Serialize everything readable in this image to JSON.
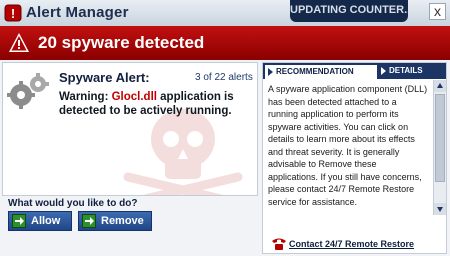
{
  "window": {
    "title": "Alert Manager",
    "counter_text": "UPDATING COUNTER...",
    "close_label": "x"
  },
  "banner": {
    "text": "20 spyware detected"
  },
  "alert": {
    "title": "Spyware Alert:",
    "count": "3 of 22 alerts",
    "warning_prefix": "Warning: ",
    "dll_name": "Glocl.dll",
    "warning_suffix": " application is detected to be actively running."
  },
  "actions": {
    "prompt": "What would you like to do?",
    "allow_label": "Allow",
    "remove_label": "Remove"
  },
  "tabs": [
    {
      "label": "RECOMMENDATION",
      "active": true
    },
    {
      "label": "DETAILS",
      "active": false
    }
  ],
  "recommendation_text": "A spyware application component (DLL) has been detected attached to a running application to perform its spyware activities. You can click on details to learn more about its effects and threat severity.   It is generally advisable to Remove these applications. If you still have concerns, please contact 24/7 Remote Restore service for assistance.",
  "contact_link": "Contact 24/7 Remote Restore",
  "colors": {
    "banner_red": "#b30000",
    "navy": "#1c3564",
    "button_blue": "#2a56a0",
    "dll_red": "#c00000"
  },
  "icons": [
    "alert-manager-logo-icon",
    "warning-icon",
    "gears-icon",
    "skull-crossbones-icon",
    "arrow-right-icon",
    "phone-icon",
    "close-icon"
  ]
}
